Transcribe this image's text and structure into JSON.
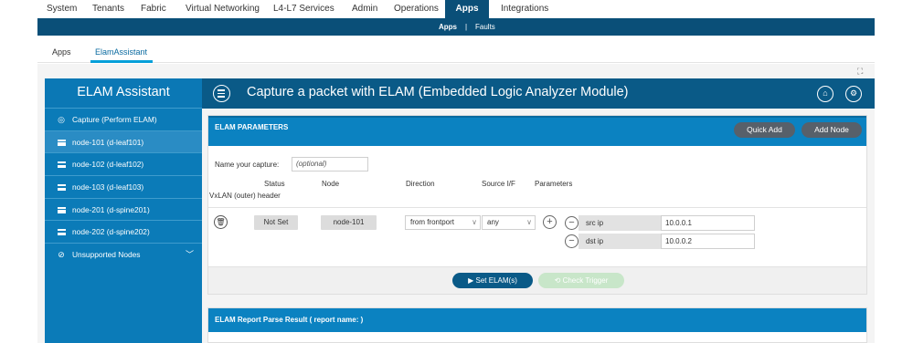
{
  "top_nav": {
    "tabs": [
      "System",
      "Tenants",
      "Fabric",
      "Virtual Networking",
      "L4-L7 Services",
      "Admin",
      "Operations",
      "Apps",
      "Integrations"
    ],
    "active": "Apps"
  },
  "sub_nav": {
    "items": [
      "Apps",
      "|",
      "Faults"
    ]
  },
  "app_tabs": {
    "apps": "Apps",
    "elam": "ElamAssistant"
  },
  "sidebar": {
    "title": "ELAM Assistant",
    "items": [
      {
        "label": "Capture (Perform ELAM)",
        "icon": "target-icon"
      },
      {
        "label": "node-101 (d-leaf101)",
        "icon": "list-icon"
      },
      {
        "label": "node-102 (d-leaf102)",
        "icon": "list-icon"
      },
      {
        "label": "node-103 (d-leaf103)",
        "icon": "list-icon"
      },
      {
        "label": "node-201 (d-spine201)",
        "icon": "list-icon"
      },
      {
        "label": "node-202 (d-spine202)",
        "icon": "list-icon"
      },
      {
        "label": "Unsupported Nodes",
        "icon": "ban-icon"
      }
    ]
  },
  "header": {
    "title": "Capture a packet with ELAM (Embedded Logic Analyzer Module)"
  },
  "elam_params": {
    "title": "ELAM PARAMETERS",
    "quick_add": "Quick Add",
    "add_node": "Add Node",
    "name_label": "Name your capture:",
    "name_placeholder": "(optional)",
    "columns": {
      "status": "Status",
      "node": "Node",
      "direction": "Direction",
      "source_if": "Source I/F",
      "parameters": "Parameters",
      "vxlan": "VxLAN (outer) header"
    },
    "row": {
      "status": "Not Set",
      "node": "node-101",
      "direction": "from frontport",
      "source_if": "any",
      "params": [
        {
          "name": "src ip",
          "value": "10.0.0.1"
        },
        {
          "name": "dst ip",
          "value": "10.0.0.2"
        }
      ]
    },
    "set_elam": "Set ELAM(s)",
    "check_trigger": "Check Trigger"
  },
  "report": {
    "title": "ELAM Report Parse Result ( report name: )"
  },
  "colors": {
    "nav_dark": "#0a4f78",
    "sidebar": "#0b7bb8",
    "header": "#0a5a87",
    "panel_head": "#0b82c1",
    "check_trigger": "#c8e6c9"
  }
}
